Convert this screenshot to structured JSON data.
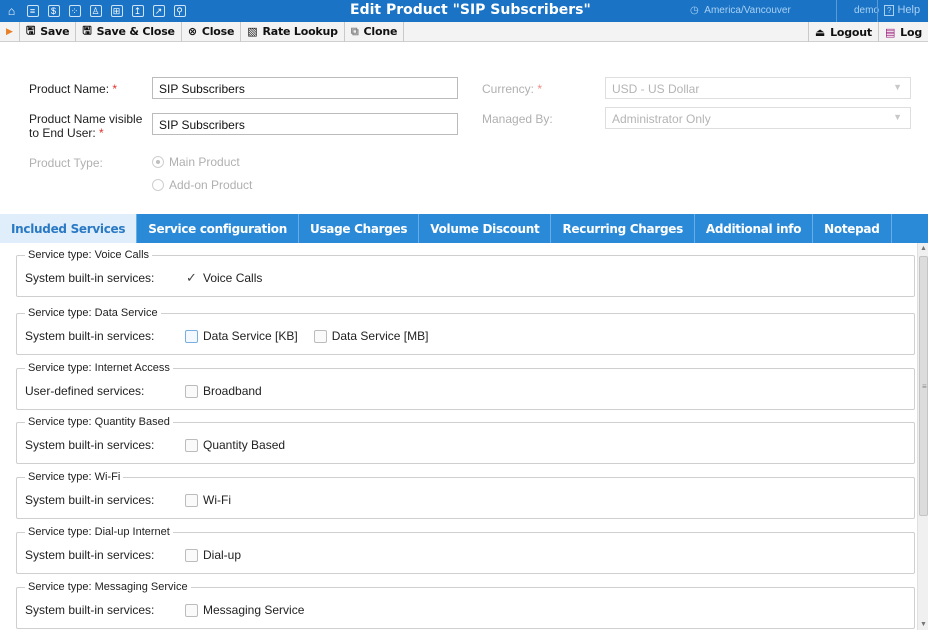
{
  "topbar": {
    "icons": [
      "home-icon",
      "list-icon",
      "dollar-icon",
      "grid-icon",
      "person-icon",
      "network-icon",
      "export-icon",
      "chart-icon",
      "search-icon"
    ],
    "title": "Edit Product \"SIP Subscribers\"",
    "timezone": "America/Vancouver",
    "user": "demo",
    "help": "Help",
    "bg_color": "#1a73c4"
  },
  "toolbar": {
    "save": "Save",
    "save_close": "Save & Close",
    "close": "Close",
    "rate_lookup": "Rate Lookup",
    "clone": "Clone",
    "logout": "Logout",
    "log": "Log"
  },
  "form": {
    "product_name_label": "Product Name:",
    "product_name_value": "SIP Subscribers",
    "visible_name_label_1": "Product Name visible",
    "visible_name_label_2": "to End User:",
    "visible_name_value": "SIP Subscribers",
    "product_type_label": "Product Type:",
    "main_product": "Main Product",
    "addon_product": "Add-on Product",
    "currency_label": "Currency:",
    "currency_value": "USD - US Dollar",
    "managed_by_label": "Managed By:",
    "managed_by_value": "Administrator Only",
    "required_mark": "*"
  },
  "tabs": [
    {
      "label": "Included Services",
      "active": true
    },
    {
      "label": "Service configuration",
      "active": false
    },
    {
      "label": "Usage Charges",
      "active": false
    },
    {
      "label": "Volume Discount",
      "active": false
    },
    {
      "label": "Recurring Charges",
      "active": false
    },
    {
      "label": "Additional info",
      "active": false
    },
    {
      "label": "Notepad",
      "active": false
    }
  ],
  "services": [
    {
      "legend": "Service type: Voice Calls",
      "row_label": "System built-in services:",
      "options": [
        {
          "label": "Voice Calls",
          "checked": true
        }
      ]
    },
    {
      "legend": "Service type: Data Service",
      "row_label": "System built-in services:",
      "options": [
        {
          "label": "Data Service [KB]",
          "checked": false
        },
        {
          "label": "Data Service [MB]",
          "checked": false
        }
      ]
    },
    {
      "legend": "Service type: Internet Access",
      "row_label": "User-defined services:",
      "options": [
        {
          "label": "Broadband",
          "checked": false
        }
      ]
    },
    {
      "legend": "Service type: Quantity Based",
      "row_label": "System built-in services:",
      "options": [
        {
          "label": "Quantity Based",
          "checked": false
        }
      ]
    },
    {
      "legend": "Service type: Wi-Fi",
      "row_label": "System built-in services:",
      "options": [
        {
          "label": "Wi-Fi",
          "checked": false
        }
      ]
    },
    {
      "legend": "Service type: Dial-up Internet",
      "row_label": "System built-in services:",
      "options": [
        {
          "label": "Dial-up",
          "checked": false
        }
      ]
    },
    {
      "legend": "Service type: Messaging Service",
      "row_label": "System built-in services:",
      "options": [
        {
          "label": "Messaging Service",
          "checked": false
        }
      ]
    }
  ],
  "colors": {
    "tab_bg": "#2a8ad8",
    "tab_active_bg": "#dfeefa",
    "required": "#e2322b",
    "annotation_arrow": "#c0392b"
  }
}
